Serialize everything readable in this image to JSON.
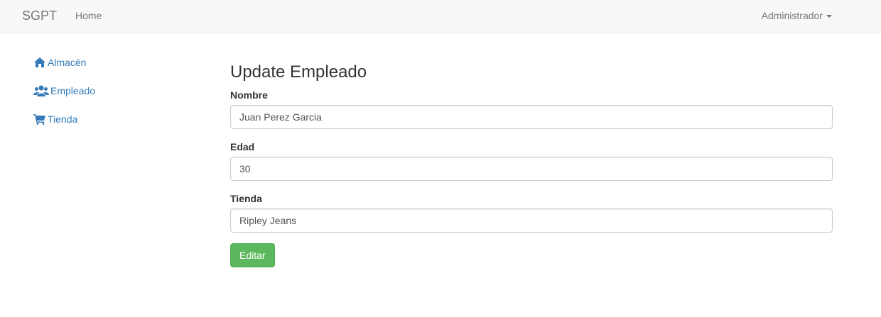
{
  "navbar": {
    "brand": "SGPT",
    "home_label": "Home",
    "user_label": "Administrador"
  },
  "sidebar": {
    "items": [
      {
        "label": "Almacén",
        "icon": "home-icon"
      },
      {
        "label": "Empleado",
        "icon": "users-icon"
      },
      {
        "label": "Tienda",
        "icon": "shopping-cart-icon"
      }
    ]
  },
  "form": {
    "title": "Update Empleado",
    "fields": [
      {
        "label": "Nombre",
        "value": "Juan Perez Garcia"
      },
      {
        "label": "Edad",
        "value": "30"
      },
      {
        "label": "Tienda",
        "value": "Ripley Jeans"
      }
    ],
    "submit_label": "Editar"
  },
  "colors": {
    "link": "#337ab7",
    "button": "#5cb85c",
    "navbar_bg": "#f8f8f8"
  }
}
